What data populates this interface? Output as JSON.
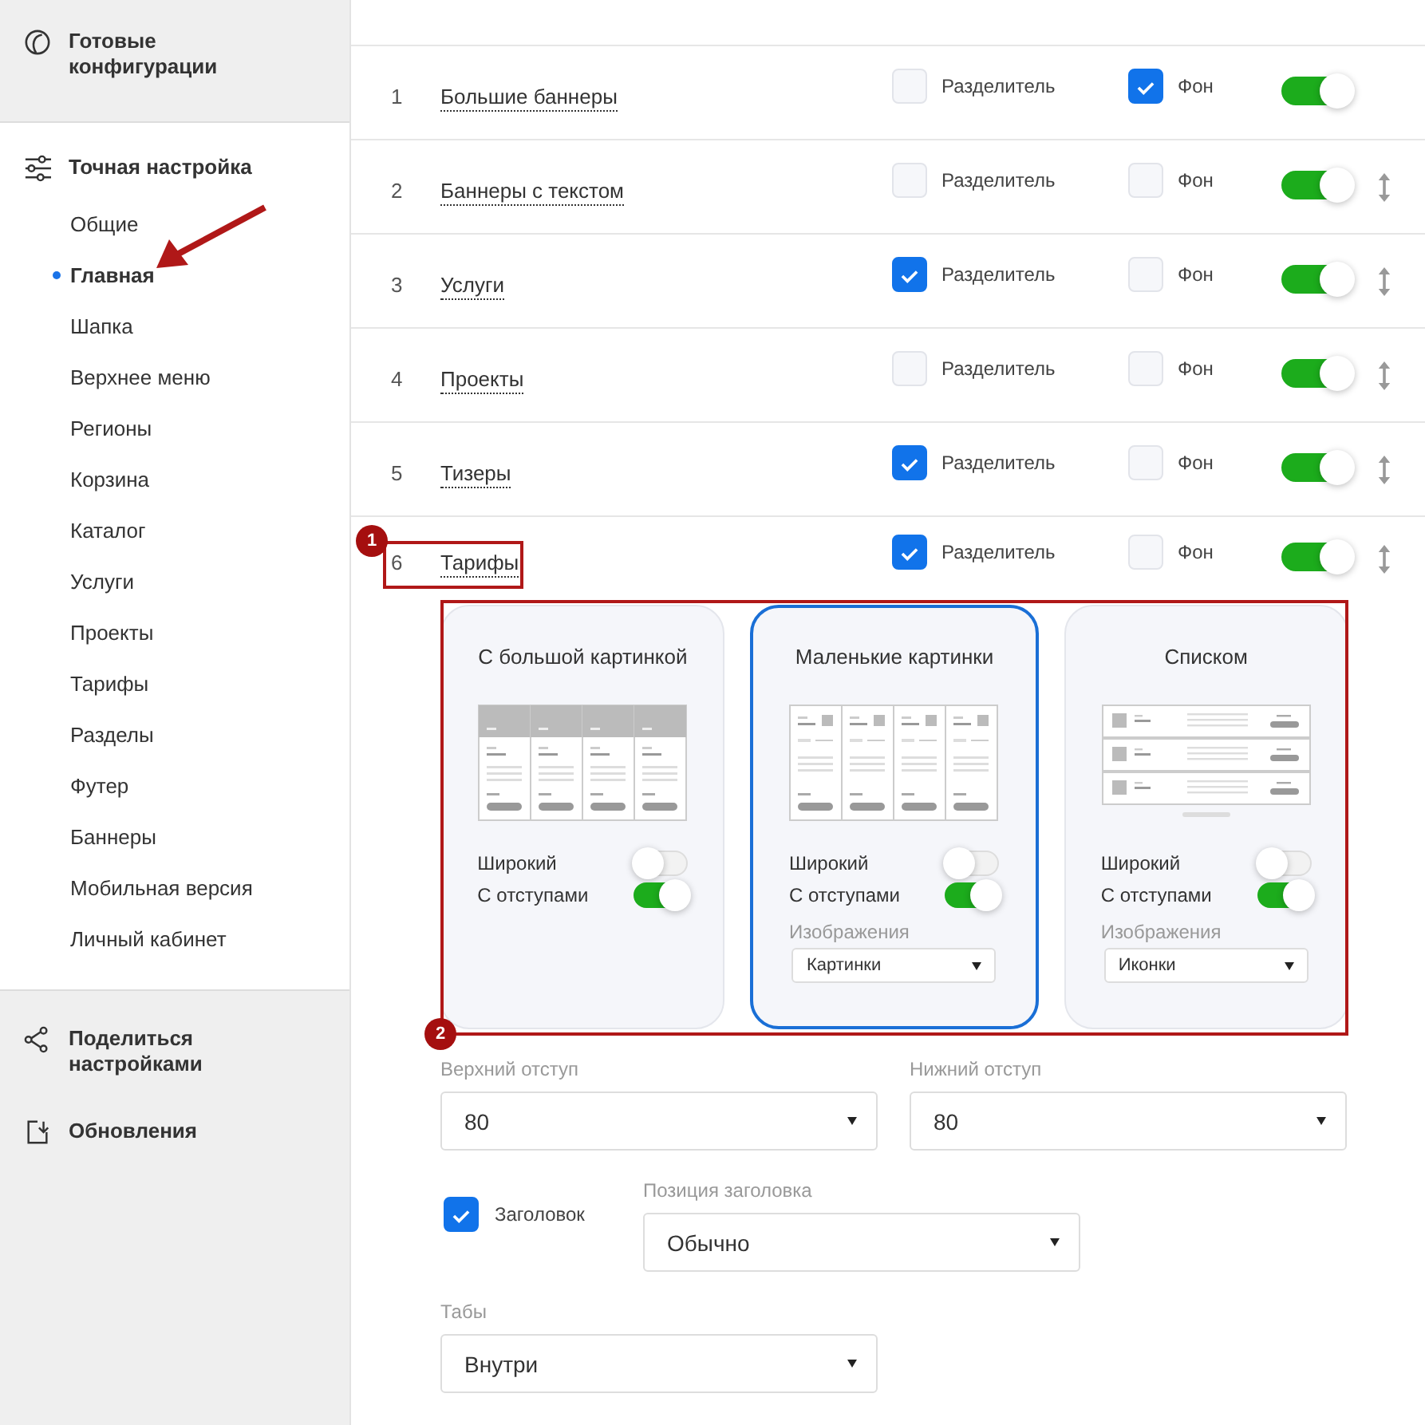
{
  "sidebar": {
    "sections": [
      {
        "title": "Готовые конфигурации",
        "expanded": false
      },
      {
        "title": "Точная настройка",
        "expanded": true,
        "items": [
          {
            "label": "Общие",
            "selected": false
          },
          {
            "label": "Главная",
            "selected": true
          },
          {
            "label": "Шапка",
            "selected": false
          },
          {
            "label": "Верхнее меню",
            "selected": false
          },
          {
            "label": "Регионы",
            "selected": false
          },
          {
            "label": "Корзина",
            "selected": false
          },
          {
            "label": "Каталог",
            "selected": false
          },
          {
            "label": "Услуги",
            "selected": false
          },
          {
            "label": "Проекты",
            "selected": false
          },
          {
            "label": "Тарифы",
            "selected": false
          },
          {
            "label": "Разделы",
            "selected": false
          },
          {
            "label": "Футер",
            "selected": false
          },
          {
            "label": "Баннеры",
            "selected": false
          },
          {
            "label": "Мобильная версия",
            "selected": false
          },
          {
            "label": "Личный кабинет",
            "selected": false
          }
        ]
      },
      {
        "title": "Поделиться настройками",
        "expanded": false
      },
      {
        "title": "Обновления",
        "expanded": false
      }
    ]
  },
  "blocks": [
    {
      "number": "1",
      "name": "Большие баннеры",
      "divider": {
        "label": "Разделитель",
        "checked": false
      },
      "background": {
        "label": "Фон",
        "checked": true
      },
      "on": true,
      "draggable": false,
      "expanded": false
    },
    {
      "number": "2",
      "name": "Баннеры с текстом",
      "divider": {
        "label": "Разделитель",
        "checked": false
      },
      "background": {
        "label": "Фон",
        "checked": false
      },
      "on": true,
      "draggable": true,
      "expanded": false
    },
    {
      "number": "3",
      "name": "Услуги",
      "divider": {
        "label": "Разделитель",
        "checked": true
      },
      "background": {
        "label": "Фон",
        "checked": false
      },
      "on": true,
      "draggable": true,
      "expanded": false
    },
    {
      "number": "4",
      "name": "Проекты",
      "divider": {
        "label": "Разделитель",
        "checked": false
      },
      "background": {
        "label": "Фон",
        "checked": false
      },
      "on": true,
      "draggable": true,
      "expanded": false
    },
    {
      "number": "5",
      "name": "Тизеры",
      "divider": {
        "label": "Разделитель",
        "checked": true
      },
      "background": {
        "label": "Фон",
        "checked": false
      },
      "on": true,
      "draggable": true,
      "expanded": false
    },
    {
      "number": "6",
      "name": "Тарифы",
      "divider": {
        "label": "Разделитель",
        "checked": true
      },
      "background": {
        "label": "Фон",
        "checked": false
      },
      "on": true,
      "draggable": true,
      "expanded": true
    }
  ],
  "layouts": [
    {
      "title": "С большой картинкой",
      "selected": false,
      "kind": "large",
      "options": [
        {
          "label": "Широкий",
          "on": false
        },
        {
          "label": "С отступами",
          "on": true
        }
      ]
    },
    {
      "title": "Маленькие картинки",
      "selected": true,
      "kind": "small",
      "options": [
        {
          "label": "Широкий",
          "on": false
        },
        {
          "label": "С отступами",
          "on": true
        }
      ],
      "images": {
        "label": "Изображения",
        "value": "Картинки"
      }
    },
    {
      "title": "Списком",
      "selected": false,
      "kind": "list",
      "options": [
        {
          "label": "Широкий",
          "on": false
        },
        {
          "label": "С отступами",
          "on": true
        }
      ],
      "images": {
        "label": "Изображения",
        "value": "Иконки"
      }
    }
  ],
  "settings": {
    "top_padding": {
      "label": "Верхний отступ",
      "value": "80"
    },
    "bottom_padding": {
      "label": "Нижний отступ",
      "value": "80"
    },
    "heading": {
      "label": "Заголовок",
      "checked": true
    },
    "heading_position": {
      "label": "Позиция заголовка",
      "value": "Обычно"
    },
    "tabs": {
      "label": "Табы",
      "value": "Внутри"
    }
  },
  "annotations": [
    {
      "label": "1"
    },
    {
      "label": "2"
    }
  ]
}
